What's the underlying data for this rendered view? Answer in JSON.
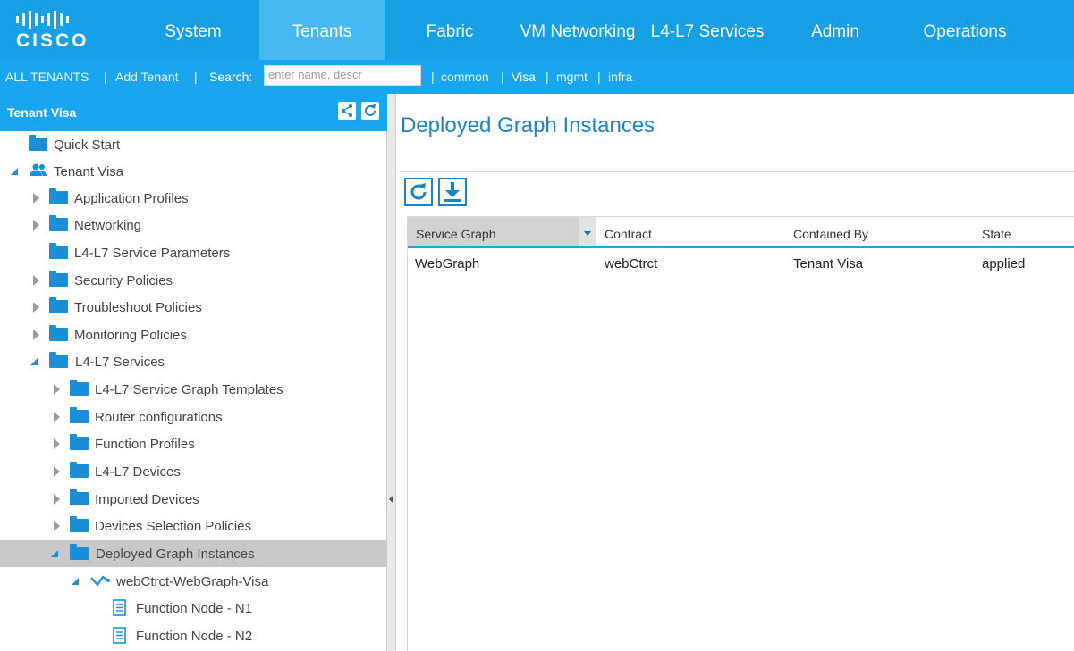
{
  "brand": {
    "word": "CISCO"
  },
  "nav": {
    "tabs": [
      {
        "label": "System"
      },
      {
        "label": "Tenants"
      },
      {
        "label": "Fabric"
      },
      {
        "label": "VM Networking"
      },
      {
        "label": "L4-L7 Services"
      },
      {
        "label": "Admin"
      },
      {
        "label": "Operations"
      }
    ]
  },
  "subnav": {
    "all_tenants": "ALL TENANTS",
    "sep1": "|",
    "add_tenant": "Add Tenant",
    "sep2": "|",
    "search_label": "Search:",
    "search_placeholder": "enter name, descr",
    "tenants": [
      "common",
      "Visa",
      "mgmt",
      "infra"
    ],
    "sep": "|"
  },
  "left_panel": {
    "title": "Tenant Visa",
    "tree": [
      {
        "label": "Quick Start"
      },
      {
        "label": "Tenant Visa"
      },
      {
        "label": "Application Profiles"
      },
      {
        "label": "Networking"
      },
      {
        "label": "L4-L7 Service Parameters"
      },
      {
        "label": "Security Policies"
      },
      {
        "label": "Troubleshoot Policies"
      },
      {
        "label": "Monitoring Policies"
      },
      {
        "label": "L4-L7 Services"
      },
      {
        "label": "L4-L7 Service Graph Templates"
      },
      {
        "label": "Router configurations"
      },
      {
        "label": "Function Profiles"
      },
      {
        "label": "L4-L7 Devices"
      },
      {
        "label": "Imported Devices"
      },
      {
        "label": "Devices Selection Policies"
      },
      {
        "label": "Deployed Graph Instances"
      },
      {
        "label": "webCtrct-WebGraph-Visa"
      },
      {
        "label": "Function Node - N1"
      },
      {
        "label": "Function Node - N2"
      }
    ]
  },
  "main": {
    "title": "Deployed Graph Instances",
    "table": {
      "columns": [
        "Service Graph",
        "Contract",
        "Contained By",
        "State"
      ],
      "rows": [
        [
          "WebGraph",
          "webCtrct",
          "Tenant Visa",
          "applied"
        ]
      ]
    }
  },
  "colors": {
    "nav_bg": "#18a0e6",
    "nav_active": "#47b8f2",
    "accent": "#1a84c8",
    "folder": "#1a8fd8",
    "selected_row": "#c8c8c8"
  }
}
